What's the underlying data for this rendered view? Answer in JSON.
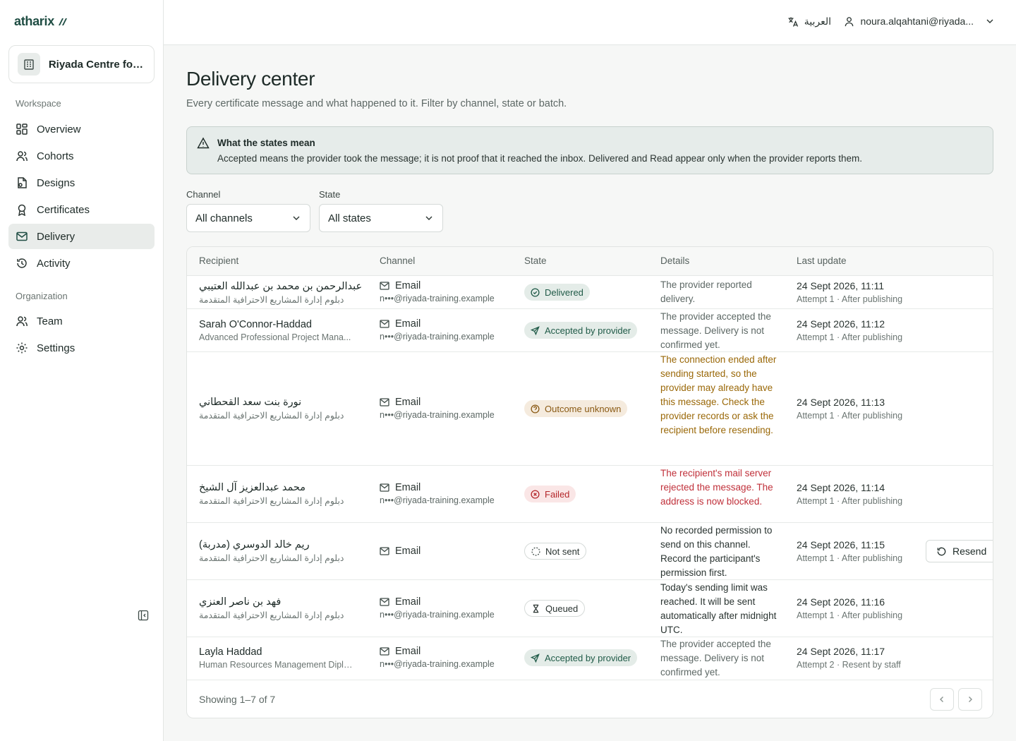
{
  "brand": {
    "name": "atharix"
  },
  "org": {
    "name": "Riyada Centre for ..."
  },
  "sidebar": {
    "workspace_label": "Workspace",
    "organization_label": "Organization",
    "items": [
      {
        "label": "Overview",
        "icon": "grid-icon"
      },
      {
        "label": "Cohorts",
        "icon": "users-icon"
      },
      {
        "label": "Designs",
        "icon": "file-design-icon"
      },
      {
        "label": "Certificates",
        "icon": "award-icon"
      },
      {
        "label": "Delivery",
        "icon": "mail-icon",
        "active": true
      },
      {
        "label": "Activity",
        "icon": "history-icon"
      }
    ],
    "org_items": [
      {
        "label": "Team",
        "icon": "users-icon"
      },
      {
        "label": "Settings",
        "icon": "gear-icon"
      }
    ]
  },
  "topbar": {
    "language": "العربية",
    "user": "noura.alqahtani@riyada..."
  },
  "page": {
    "title": "Delivery center",
    "subtitle": "Every certificate message and what happened to it. Filter by channel, state or batch."
  },
  "notice": {
    "title": "What the states mean",
    "body": "Accepted means the provider took the message; it is not proof that it reached the inbox. Delivered and Read appear only when the provider reports them."
  },
  "filters": {
    "channel_label": "Channel",
    "channel_value": "All channels",
    "state_label": "State",
    "state_value": "All states"
  },
  "table": {
    "headers": {
      "recipient": "Recipient",
      "channel": "Channel",
      "state": "State",
      "details": "Details",
      "last_update": "Last update"
    },
    "rows": [
      {
        "name": "عبدالرحمن بن محمد بن عبدالله العتيبي",
        "program": "دبلوم إدارة المشاريع الاحترافية المتقدمة",
        "channel": "Email",
        "address": "n•••@riyada-training.example",
        "state": "Delivered",
        "details": "The provider reported delivery.",
        "date": "24 Sept 2026, 11:11",
        "attempt": "Attempt 1 · After publishing"
      },
      {
        "name": "Sarah O'Connor-Haddad",
        "program": "Advanced Professional Project Mana...",
        "channel": "Email",
        "address": "n•••@riyada-training.example",
        "state": "Accepted by provider",
        "details": "The provider accepted the message. Delivery is not confirmed yet.",
        "date": "24 Sept 2026, 11:12",
        "attempt": "Attempt 1 · After publishing"
      },
      {
        "name": "نورة بنت سعد القحطاني",
        "program": "دبلوم إدارة المشاريع الاحترافية المتقدمة",
        "channel": "Email",
        "address": "n•••@riyada-training.example",
        "state": "Outcome unknown",
        "details": "The connection ended after sending started, so the provider may already have this message. Check the provider records or ask the recipient before resending.",
        "date": "24 Sept 2026, 11:13",
        "attempt": "Attempt 1 · After publishing"
      },
      {
        "name": "محمد عبدالعزيز آل الشيخ",
        "program": "دبلوم إدارة المشاريع الاحترافية المتقدمة",
        "channel": "Email",
        "address": "n•••@riyada-training.example",
        "state": "Failed",
        "details": "The recipient's mail server rejected the message. The address is now blocked.",
        "date": "24 Sept 2026, 11:14",
        "attempt": "Attempt 1 · After publishing"
      },
      {
        "name": "ريم خالد الدوسري (مدربة)",
        "program": "دبلوم إدارة المشاريع الاحترافية المتقدمة",
        "channel": "Email",
        "address": "",
        "state": "Not sent",
        "details": "No recorded permission to send on this channel. Record the participant's permission first.",
        "date": "24 Sept 2026, 11:15",
        "attempt": "Attempt 1 · After publishing",
        "action": "Resend"
      },
      {
        "name": "فهد بن ناصر العنزي",
        "program": "دبلوم إدارة المشاريع الاحترافية المتقدمة",
        "channel": "Email",
        "address": "n•••@riyada-training.example",
        "state": "Queued",
        "details": "Today's sending limit was reached. It will be sent automatically after midnight UTC.",
        "date": "24 Sept 2026, 11:16",
        "attempt": "Attempt 1 · After publishing"
      },
      {
        "name": "Layla Haddad",
        "program": "Human Resources Management Diplo...",
        "channel": "Email",
        "address": "n•••@riyada-training.example",
        "state": "Accepted by provider",
        "details": "The provider accepted the message. Delivery is not confirmed yet.",
        "date": "24 Sept 2026, 11:17",
        "attempt": "Attempt 2 · Resent by staff"
      }
    ],
    "footer": "Showing 1–7 of 7"
  }
}
